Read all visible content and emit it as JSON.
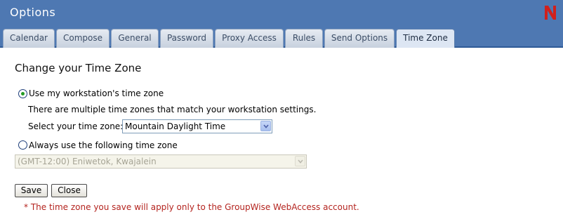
{
  "window": {
    "title": "Options",
    "logo_letter": "N",
    "logo_color": "#d0201c"
  },
  "tabs": [
    {
      "label": "Calendar",
      "active": false
    },
    {
      "label": "Compose",
      "active": false
    },
    {
      "label": "General",
      "active": false
    },
    {
      "label": "Password",
      "active": false
    },
    {
      "label": "Proxy Access",
      "active": false
    },
    {
      "label": "Rules",
      "active": false
    },
    {
      "label": "Send Options",
      "active": false
    },
    {
      "label": "Time Zone",
      "active": true
    }
  ],
  "page": {
    "heading": "Change your Time Zone",
    "option_workstation": {
      "label": "Use my workstation's time zone",
      "checked": true,
      "info": "There are multiple time zones that match your workstation settings.",
      "select_label": "Select your time zone:",
      "select_value": "Mountain Daylight Time"
    },
    "option_fixed": {
      "label": "Always use the following time zone",
      "checked": false,
      "select_value": "(GMT-12:00) Eniwetok, Kwajalein",
      "select_disabled": true
    },
    "buttons": {
      "save": "Save",
      "close": "Close"
    },
    "note": "* The time zone you save will apply only to the GroupWise WebAccess account."
  },
  "colors": {
    "header_bg": "#4e78b2",
    "note_text": "#b4241f",
    "radio_dot": "#239b23"
  },
  "icons": {
    "logo": "novell-n-icon",
    "dropdown": "chevron-down-icon"
  }
}
